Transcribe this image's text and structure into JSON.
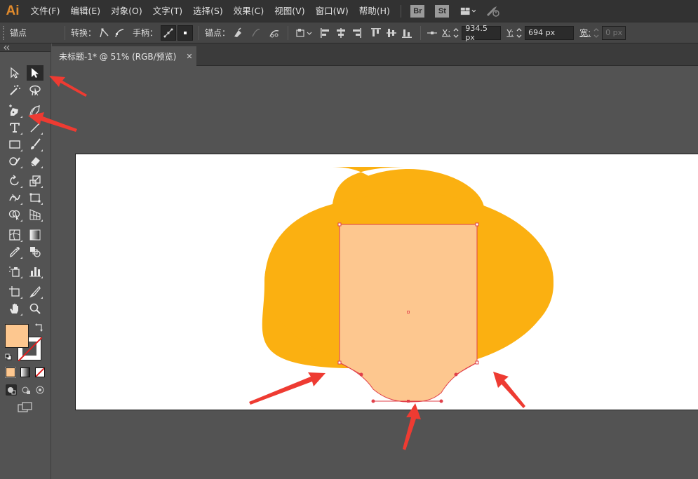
{
  "app": {
    "logo": "Ai"
  },
  "menu": {
    "items": [
      "文件(F)",
      "编辑(E)",
      "对象(O)",
      "文字(T)",
      "选择(S)",
      "效果(C)",
      "视图(V)",
      "窗口(W)",
      "帮助(H)"
    ],
    "bridge_label": "Br",
    "stock_label": "St"
  },
  "control_bar": {
    "section_label": "锚点",
    "convert_label": "转换：",
    "handles_label": "手柄：",
    "anchors_label": "锚点：",
    "x_label": "X:",
    "x_value": "934.5 px",
    "y_label": "Y:",
    "y_value": "694 px",
    "w_label": "宽:",
    "w_value": "0 px"
  },
  "document": {
    "tab_title": "未标题-1* @ 51% (RGB/预览)",
    "close_label": "✕"
  },
  "colors": {
    "app_bg": "#535353",
    "menubar_bg": "#323232",
    "fill_swatch": "#fdc78f",
    "back_shape": "#fbb011",
    "front_shape": "#fdc78f",
    "selection": "#e0404a",
    "arrow": "#ee3b32"
  },
  "icons": {
    "selection_tool": "selection-arrow-icon",
    "direct_selection_tool": "direct-selection-arrow-icon",
    "pen_tool": "pen-icon",
    "type_tool": "type-icon",
    "zoom_tool": "magnifier-icon",
    "hand_tool": "hand-icon"
  }
}
